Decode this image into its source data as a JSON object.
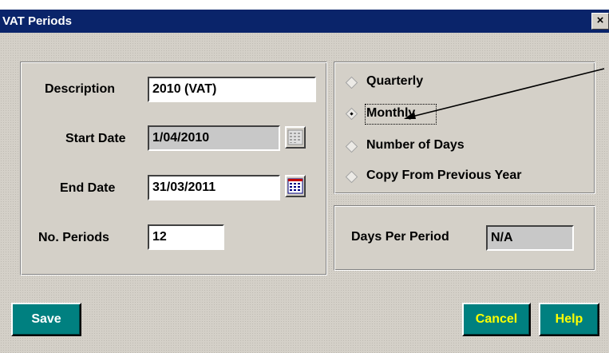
{
  "window": {
    "title": "VAT Periods",
    "close_glyph": "×"
  },
  "form": {
    "description_label": "Description",
    "description_value": "2010 (VAT)",
    "start_date_label": "Start Date",
    "start_date_value": "1/04/2010",
    "end_date_label": "End Date",
    "end_date_value": "31/03/2011",
    "no_periods_label": "No. Periods",
    "no_periods_value": "12"
  },
  "period_type": {
    "options": [
      "Quarterly",
      "Monthly",
      "Number of Days",
      "Copy From Previous Year"
    ],
    "selected": "Monthly"
  },
  "days_per_period": {
    "label": "Days Per Period",
    "value": "N/A"
  },
  "buttons": {
    "save": "Save",
    "cancel": "Cancel",
    "help": "Help"
  },
  "colors": {
    "titlebar": "#0a246a",
    "button_face": "#008080",
    "button_text": "#ffff00",
    "save_text": "#ffffff"
  }
}
